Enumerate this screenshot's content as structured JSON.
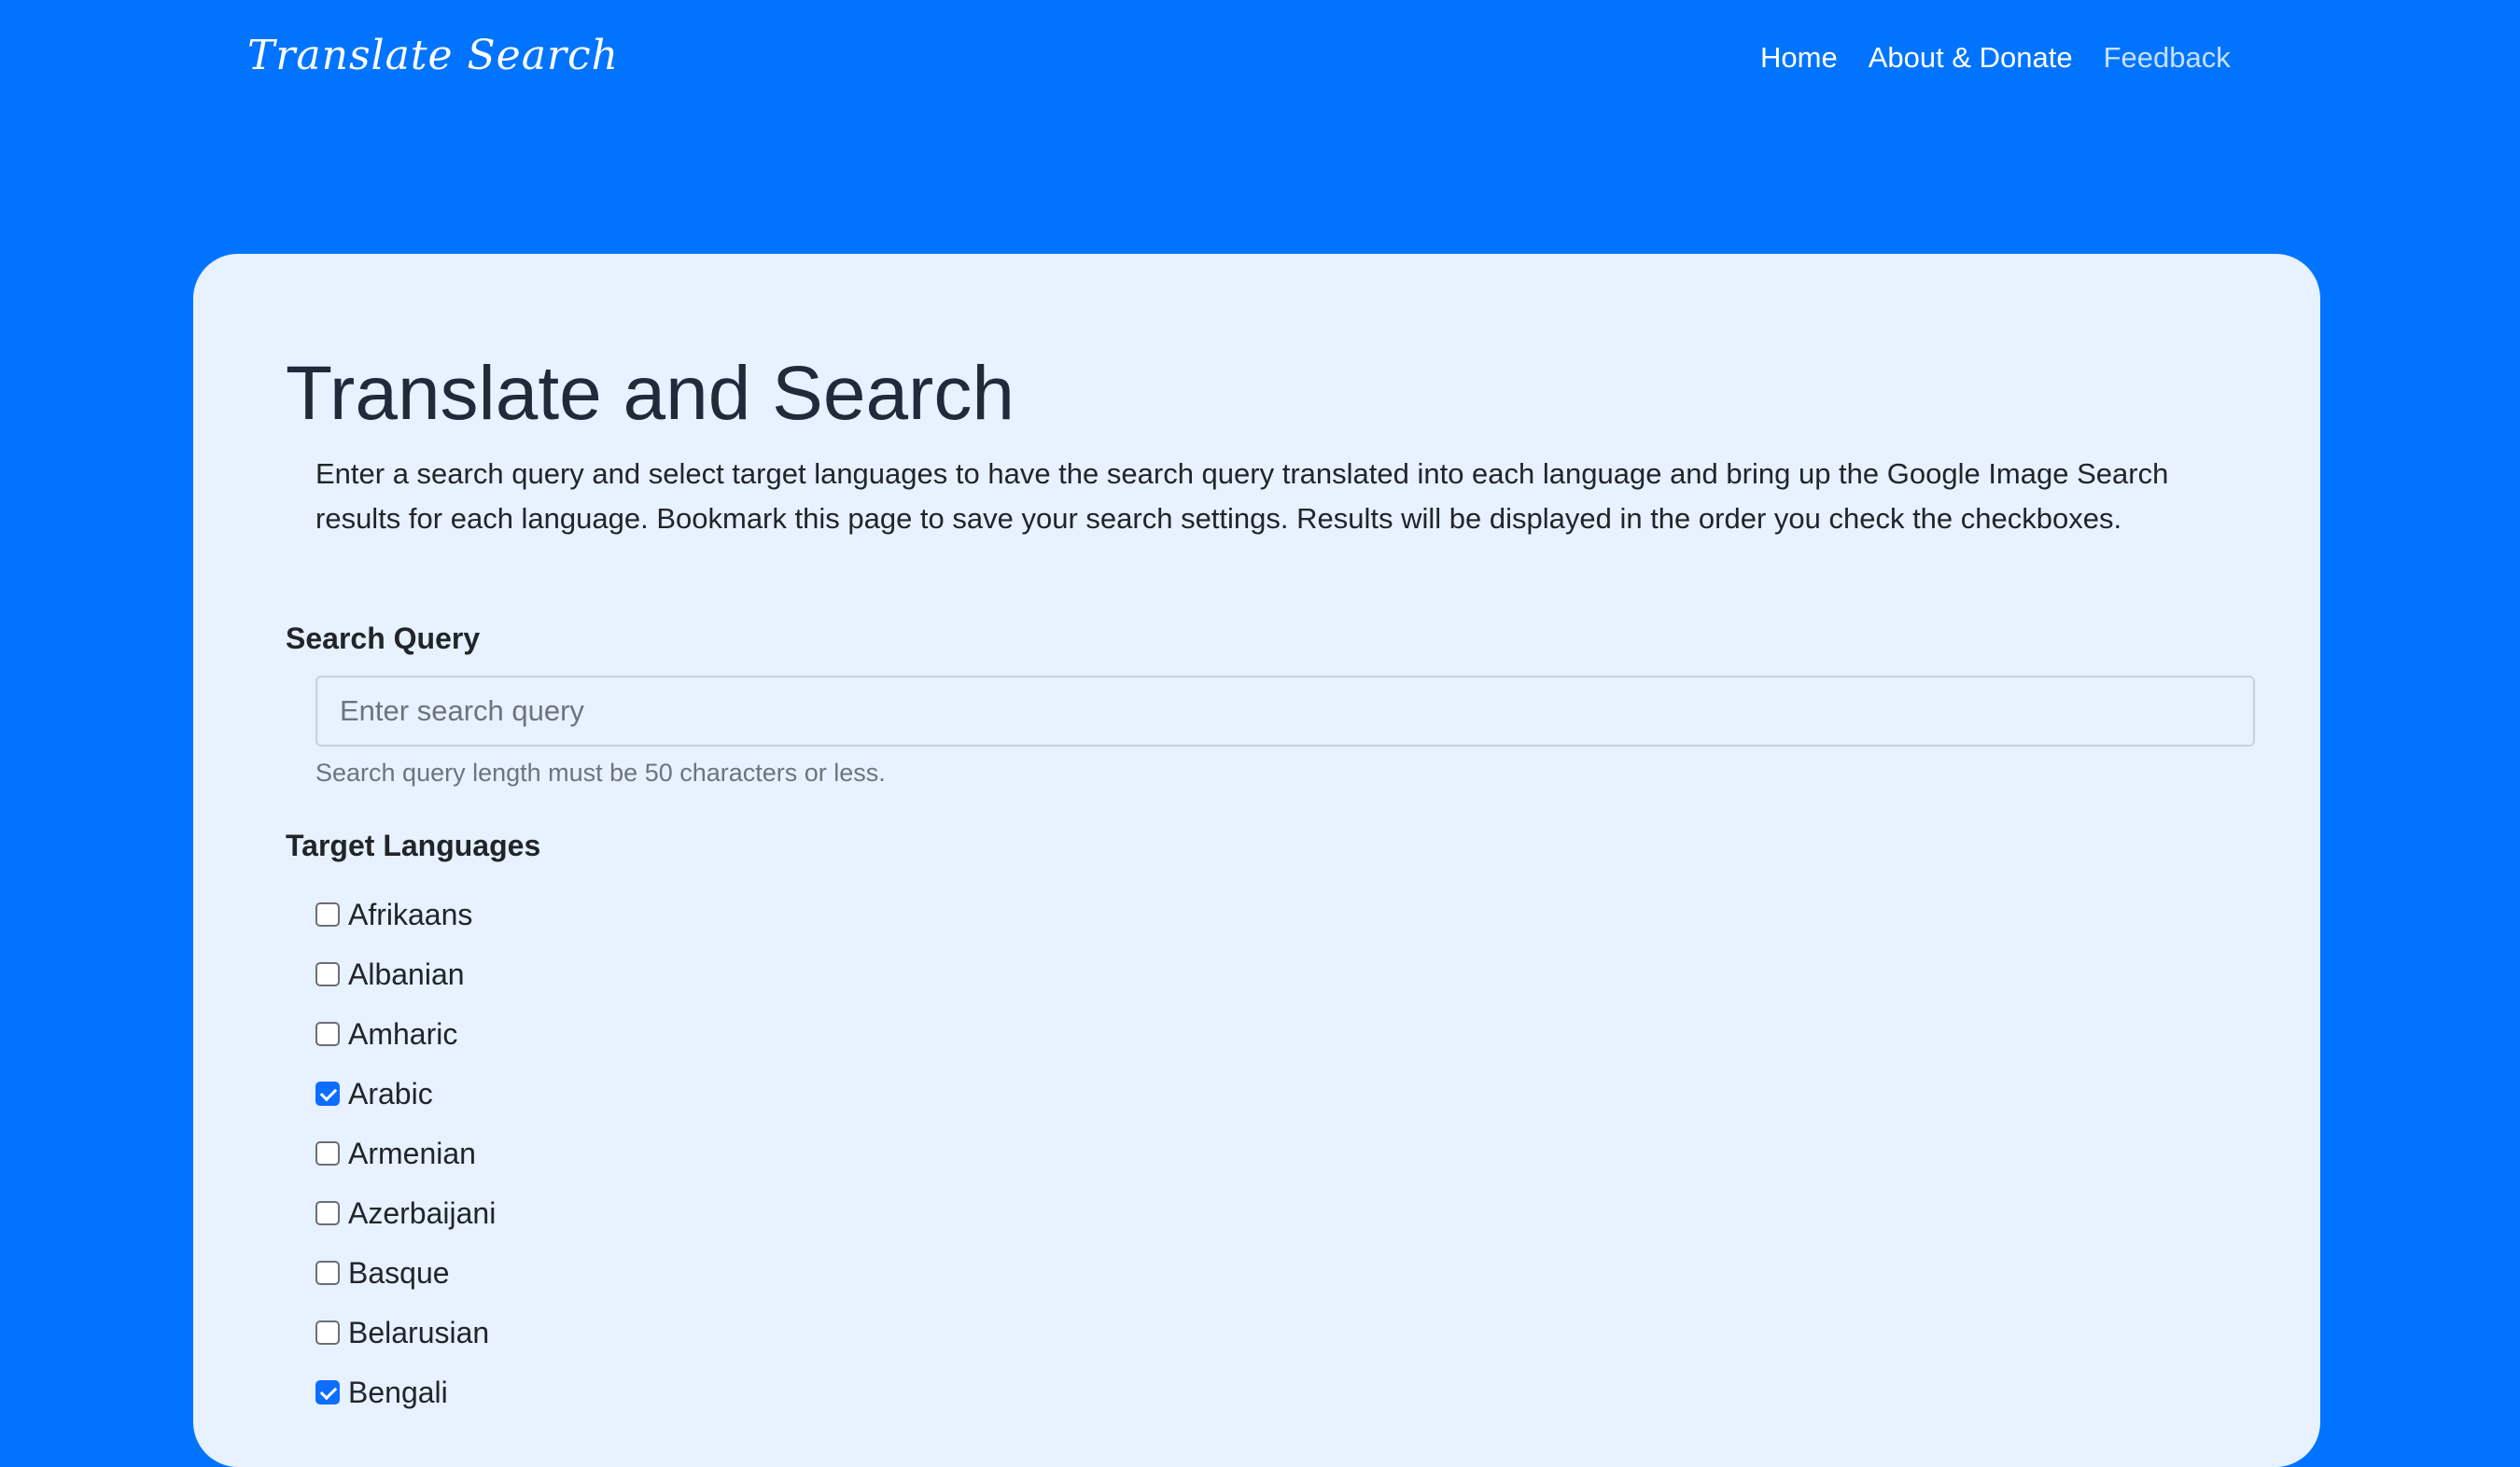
{
  "navbar": {
    "brand": "Translate Search",
    "links": [
      {
        "label": "Home",
        "muted": false
      },
      {
        "label": "About & Donate",
        "muted": false
      },
      {
        "label": "Feedback",
        "muted": true
      }
    ]
  },
  "main": {
    "title": "Translate and Search",
    "description": "Enter a search query and select target languages to have the search query translated into each language and bring up the Google Image Search results for each language. Bookmark this page to save your search settings. Results will be displayed in the order you check the checkboxes.",
    "search": {
      "label": "Search Query",
      "value": "",
      "placeholder": "Enter search query",
      "help": "Search query length must be 50 characters or less."
    },
    "languages": {
      "label": "Target Languages",
      "items": [
        {
          "name": "Afrikaans",
          "checked": false
        },
        {
          "name": "Albanian",
          "checked": false
        },
        {
          "name": "Amharic",
          "checked": false
        },
        {
          "name": "Arabic",
          "checked": true
        },
        {
          "name": "Armenian",
          "checked": false
        },
        {
          "name": "Azerbaijani",
          "checked": false
        },
        {
          "name": "Basque",
          "checked": false
        },
        {
          "name": "Belarusian",
          "checked": false
        },
        {
          "name": "Bengali",
          "checked": true
        }
      ]
    }
  },
  "colors": {
    "background": "#0074ff",
    "card": "#e7f1ff",
    "checkbox_checked": "#0d6efd",
    "muted_text": "#6c757d"
  }
}
